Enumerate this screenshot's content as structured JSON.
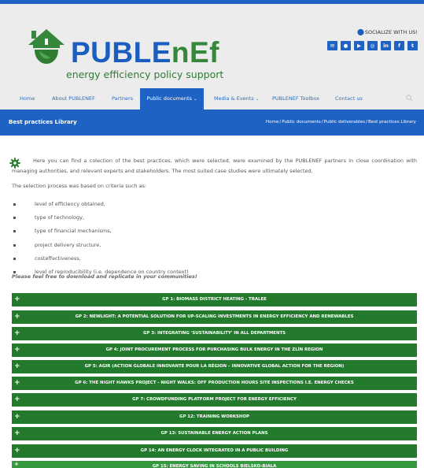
{
  "header": {
    "logo_word_a": "PUBLE",
    "logo_word_b": "nEf",
    "logo_tagline": "energy efficiency policy support",
    "socialize_label": "SOCIALIZE WITH US!",
    "social_icons": [
      {
        "name": "email-icon",
        "glyph": "✉"
      },
      {
        "name": "circle-icon",
        "glyph": "●"
      },
      {
        "name": "youtube-icon",
        "glyph": "▶"
      },
      {
        "name": "instagram-icon",
        "glyph": "◎"
      },
      {
        "name": "linkedin-icon",
        "glyph": "in"
      },
      {
        "name": "facebook-icon",
        "glyph": "f"
      },
      {
        "name": "twitter-icon",
        "glyph": "t"
      }
    ]
  },
  "nav": {
    "items": [
      {
        "label": "Home"
      },
      {
        "label": "About PUBLENEF"
      },
      {
        "label": "Partners"
      },
      {
        "label": "Public documents",
        "active": true,
        "dropdown": true
      },
      {
        "label": "Media & Events",
        "dropdown": true
      },
      {
        "label": "PUBLENEF Toolbox"
      },
      {
        "label": "Contact us"
      }
    ]
  },
  "banner": {
    "title": "Best practices Library",
    "breadcrumb": [
      "Home",
      "Public documents",
      "Public deliverables",
      "Best practices Library"
    ],
    "separator": "/"
  },
  "content": {
    "intro": "Here you can find a colection of the best practices, which were selected, were examined by the PUBLENEF partners in close coordination with managing authorities, and relevant experts and stakeholders. The most suited case studies were ultimately selected.",
    "selection_text": "The selection process was based on criteria such as:",
    "criteria": [
      "level of efficiency obtained,",
      "type of technology,",
      "type of financial mechanisms,",
      "project delivery structure,",
      "costeffectiveness,",
      "level of reproducibility (i.e. dependence on country context)"
    ],
    "download_note": "Please feel free to download and replicate in your communities!",
    "plus_glyph": "+",
    "good_practices": [
      "GP 1: BIOMASS DISTRICT HEATING - TRALEE",
      "GP 2: NEWLIGHT: A POTENTIAL SOLUTION FOR UP-SCALING INVESTMENTS IN ENERGY EFFICIENCY AND RENEWABLES",
      "GP 3: INTEGRATING 'SUSTAINABILITY' IN ALL DEPARTMENTS",
      "GP 4: JOINT PROCUREMENT PROCESS FOR PURCHASING BULK ENERGY IN THE ZLÍN REGION",
      "GP 5: AGIR (ACTION GLOBALE INNOVANTE POUR LA RÉGION – INNOVATIVE GLOBAL ACTION FOR THE REGION)",
      "GP 6: THE NIGHT HAWKS PROJECT - NIGHT WALKS: OFF PRODUCTION HOURS SITE INSPECTIONS I.E. ENERGY CHECKS",
      "GP 7: CROWDFUNDING PLATFORM PROJECT FOR ENERGY EFFICIENCY",
      "GP 12: TRAINING WORKSHOP",
      "GP 13: SUSTAINABLE ENERGY ACTION PLANS",
      "GP 14: AN ENERGY CLOCK INTEGRATED IN A PUBLIC BUILDING",
      "GP 15: ENERGY SAVING IN SCHOOLS BIELSKO-BIALA"
    ]
  },
  "colors": {
    "brand_blue": "#1e62c3",
    "brand_green": "#237a2d",
    "header_bg": "#ececec"
  }
}
